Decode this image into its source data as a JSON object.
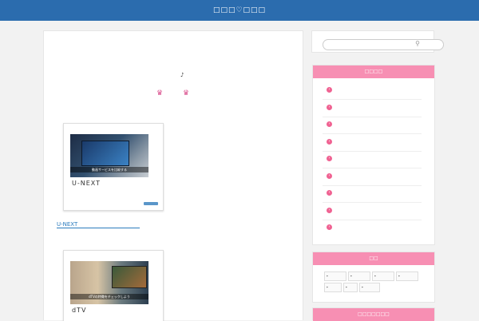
{
  "header": {
    "site_title": "□□□♡□□□"
  },
  "article": {
    "note_symbol": "♪",
    "crowns": [
      "♛",
      "♛"
    ],
    "cards": [
      {
        "title": "U-NEXT",
        "thumb_caption": "動画サービスを比較する"
      },
      {
        "title": "dTV",
        "thumb_caption": "dTVの特徴をチェックしよう"
      }
    ],
    "link_text": "U-NEXT"
  },
  "sidebar": {
    "search": {
      "placeholder": "",
      "icon": "search-icon"
    },
    "categories": {
      "heading": "□□□□",
      "items": [
        "",
        "",
        "",
        "",
        "",
        "",
        "",
        "",
        ""
      ]
    },
    "tags": {
      "heading": "□□",
      "items": [
        "",
        "",
        "",
        "",
        "",
        "",
        ""
      ]
    },
    "third_heading": "□□□□□□□"
  },
  "colors": {
    "header": "#2b6cae",
    "accent_pink": "#f78fb3",
    "link_blue": "#2b7bbd"
  }
}
